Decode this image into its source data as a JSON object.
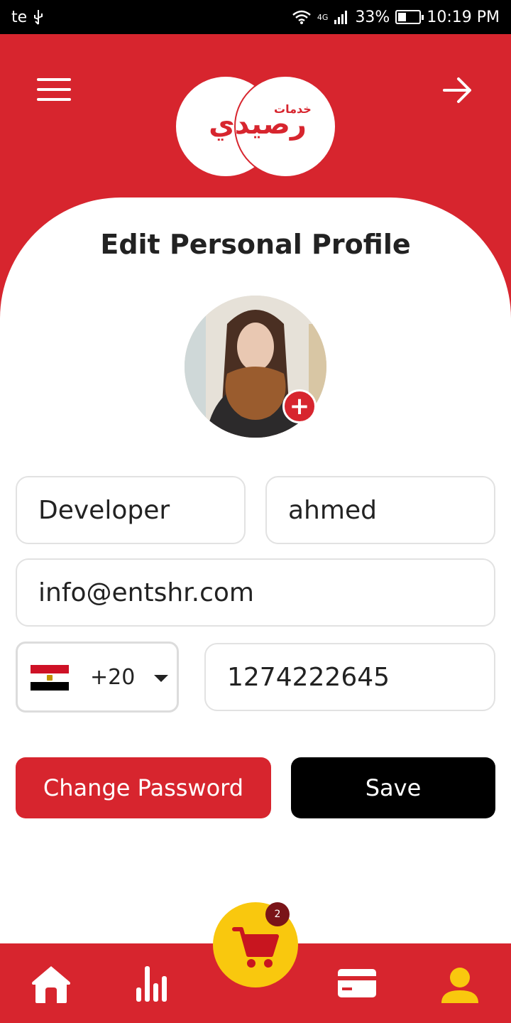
{
  "status_bar": {
    "carrier": "te",
    "network": "4G",
    "battery": "33%",
    "time": "10:19 PM"
  },
  "header": {
    "logo_word": "رصيدي",
    "logo_small": "خدمات"
  },
  "page": {
    "title": "Edit Personal Profile"
  },
  "form": {
    "last_name": "Developer",
    "first_name": "ahmed",
    "email": "info@entshr.com",
    "country_code": "+20",
    "phone": "1274222645"
  },
  "buttons": {
    "change_password": "Change Password",
    "save": "Save"
  },
  "cart": {
    "badge_count": "2"
  },
  "colors": {
    "brand_red": "#d7252e",
    "cart_yellow": "#f9c80e",
    "badge_dark_red": "#7a1418"
  },
  "icons": {
    "menu": "hamburger-menu-icon",
    "forward": "arrow-right-icon",
    "add_photo": "plus-icon",
    "home": "home-icon",
    "stats": "bar-chart-icon",
    "cart": "cart-icon",
    "card": "credit-card-icon",
    "profile": "user-icon"
  }
}
